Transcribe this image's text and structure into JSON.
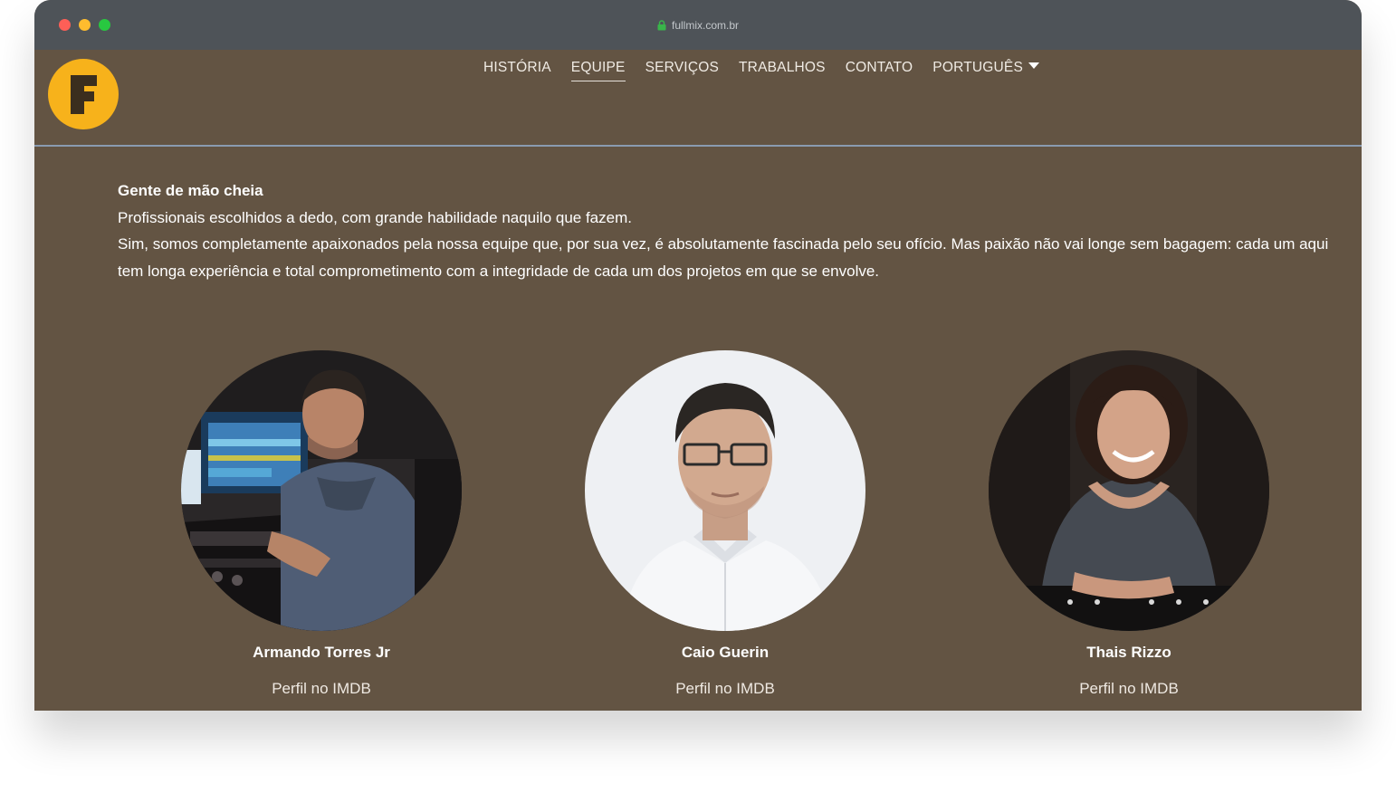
{
  "browser": {
    "url": "fullmix.com.br"
  },
  "nav": {
    "items": [
      "HISTÓRIA",
      "EQUIPE",
      "SERVIÇOS",
      "TRABALHOS",
      "CONTATO"
    ],
    "language": "PORTUGUÊS",
    "active": "EQUIPE"
  },
  "logo": {
    "letter": "F",
    "color": "#f7b21b"
  },
  "intro": {
    "heading": "Gente de mão cheia",
    "line1": "Profissionais escolhidos a dedo, com grande habilidade naquilo que fazem.",
    "line2": "Sim, somos completamente apaixonados pela nossa equipe que, por sua vez, é absolutamente fascinada pelo seu ofício. Mas paixão não vai longe sem bagagem: cada um aqui tem longa experiência e total comprometimento com a integridade de cada um dos projetos em que se envolve."
  },
  "team": [
    {
      "name": "Armando Torres Jr",
      "link": "Perfil no IMDB"
    },
    {
      "name": "Caio Guerin",
      "link": "Perfil no IMDB"
    },
    {
      "name": "Thais Rizzo",
      "link": "Perfil no IMDB"
    }
  ],
  "colors": {
    "page_bg": "#635443",
    "titlebar": "#4e5358",
    "accent": "#f7b21b"
  }
}
